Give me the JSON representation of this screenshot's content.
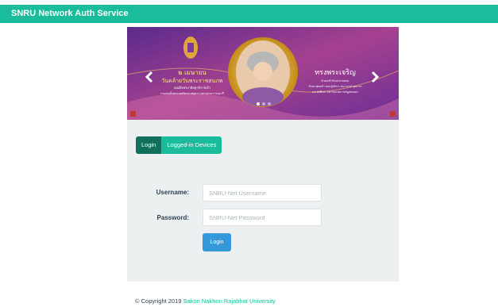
{
  "app": {
    "brand": "SNRU Network Auth Service"
  },
  "banner": {
    "left_text_lines": [
      "๒ เมษายน",
      "วันคล้ายวันพระราชสมภพ",
      "สมเด็จพระกนิษฐาธิราชเจ้า",
      "กรมสมเด็จพระเทพรัตนราชสุดาฯ สยามบรมราชกุมารี"
    ],
    "right_text_lines": [
      "ทรงพระเจริญ",
      "ด้วยเกล้าด้วยกระหม่อม",
      "ข้าพระพุทธเจ้า คณะผู้บริหาร คณาจารย์ บุคลากร",
      "และนักศึกษา มหาวิทยาลัยราชภัฏสกลนคร"
    ],
    "prev_icon": "chevron-left-icon",
    "next_icon": "chevron-right-icon",
    "colors": {
      "primary": "#7b3a9e",
      "secondary": "#b23a8a",
      "gold": "#f1c40f"
    }
  },
  "tabs": [
    {
      "label": "Login",
      "active": true
    },
    {
      "label": "Logged-in Devices",
      "active": false
    }
  ],
  "form": {
    "username_label": "Username:",
    "username_placeholder": "SNRU-Net Username",
    "password_label": "Password:",
    "password_placeholder": "SNRU-Net Password",
    "submit_label": "Login"
  },
  "footer": {
    "copyright": "© Copyright 2019",
    "org_link": "Sakon Nakhon Rajabhat University"
  },
  "colors": {
    "accent": "#1bbc9b",
    "accent_dark": "#11705b",
    "button": "#3498db",
    "panel_bg": "#ecf0f1"
  }
}
